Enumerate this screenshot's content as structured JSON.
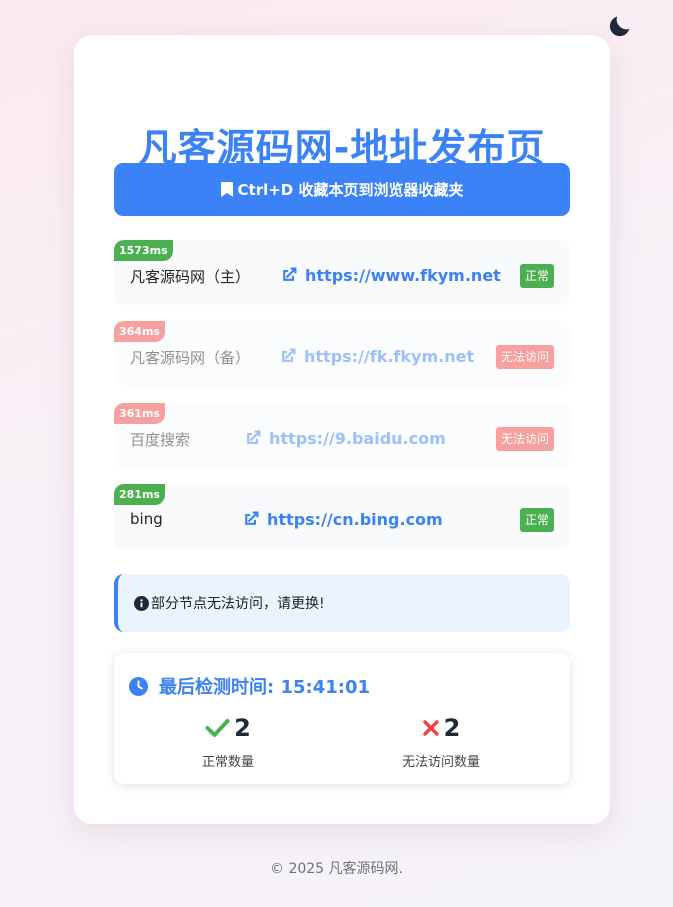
{
  "page": {
    "title": "凡客源码网-地址发布页",
    "bookmark_label": "Ctrl+D 收藏本页到浏览器收藏夹"
  },
  "links": [
    {
      "name": "凡客源码网（主）",
      "url": "https://www.fkym.net",
      "latency": "1573ms",
      "status": "正常"
    },
    {
      "name": "凡客源码网（备）",
      "url": "https://fk.fkym.net",
      "latency": "364ms",
      "status": "无法访问"
    },
    {
      "name": "百度搜索",
      "url": "https://9.baidu.com",
      "latency": "361ms",
      "status": "无法访问"
    },
    {
      "name": "bing",
      "url": "https://cn.bing.com",
      "latency": "281ms",
      "status": "正常"
    }
  ],
  "notice": {
    "text": "部分节点无法访问，请更换!"
  },
  "stats": {
    "last_check": "最后检测时间: 15:41:01",
    "ok_count": "2",
    "ok_label": "正常数量",
    "fail_count": "2",
    "fail_label": "无法访问数量"
  },
  "footer": {
    "text": "© 2025 凡客源码网."
  },
  "icons": {
    "theme": "moon-icon",
    "bookmark": "bookmark-icon",
    "link": "external-link-icon",
    "notice": "info-circle-icon",
    "time": "clock-icon",
    "ok": "check-icon",
    "fail": "x-icon"
  },
  "colors": {
    "accent": "#3b82f6",
    "ok": "#4caf50",
    "fail": "#ef4444",
    "notice_bg": "#eaf4fe"
  }
}
